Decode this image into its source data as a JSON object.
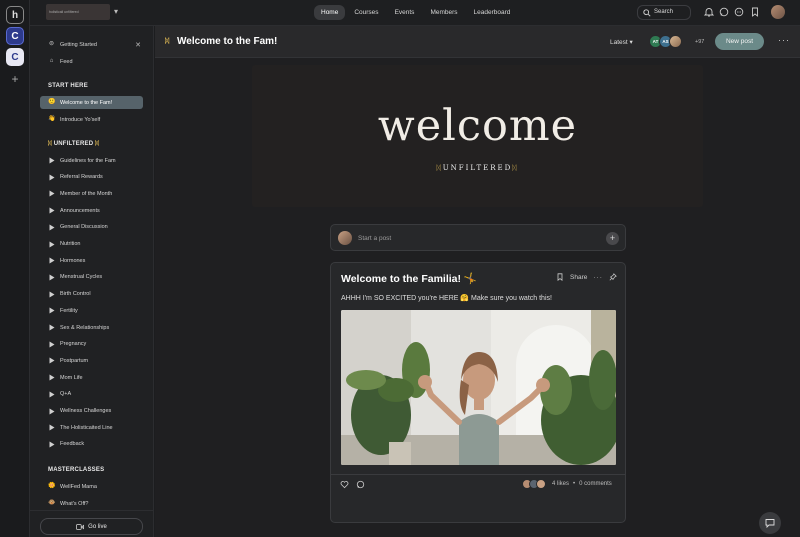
{
  "brand": {
    "logo_text": "holisticali unfiltered"
  },
  "nav": {
    "tabs": [
      {
        "label": "Home",
        "active": true
      },
      {
        "label": "Courses"
      },
      {
        "label": "Events"
      },
      {
        "label": "Members"
      },
      {
        "label": "Leaderboard"
      }
    ]
  },
  "search": {
    "label": "Search"
  },
  "rail": {
    "items": [
      {
        "label": "h",
        "icon": "holisticali-logo"
      },
      {
        "label": "C",
        "icon": "community-c-icon"
      },
      {
        "label": "C",
        "icon": "community-c-icon"
      },
      {
        "label": "+",
        "icon": "plus-icon"
      }
    ]
  },
  "sidebar": {
    "top_items": [
      {
        "label": "Getting Started",
        "icon": "checklist-icon"
      },
      {
        "label": "Feed",
        "icon": "home-icon"
      }
    ],
    "start_here": {
      "heading": "START HERE",
      "items": [
        {
          "label": "Welcome to the Fam!",
          "icon": "🙂",
          "active": true
        },
        {
          "label": "Introduce Yo'self",
          "icon": "👋"
        }
      ]
    },
    "unfiltered": {
      "heading": "UNFILTERED",
      "items": [
        {
          "label": "Guidelines for the Fam"
        },
        {
          "label": "Referral Rewards"
        },
        {
          "label": "Member of the Month"
        },
        {
          "label": "Announcements"
        },
        {
          "label": "General Discussion"
        },
        {
          "label": "Nutrition"
        },
        {
          "label": "Hormones"
        },
        {
          "label": "Menstrual Cycles"
        },
        {
          "label": "Birth Control"
        },
        {
          "label": "Fertility"
        },
        {
          "label": "Sex & Relationships"
        },
        {
          "label": "Pregnancy"
        },
        {
          "label": "Postpartum"
        },
        {
          "label": "Mom Life"
        },
        {
          "label": "Q+A"
        },
        {
          "label": "Wellness Challenges"
        },
        {
          "label": "The Holisticaited Line"
        },
        {
          "label": "Feedback"
        }
      ]
    },
    "masterclasses": {
      "heading": "MASTERCLASSES",
      "items": [
        {
          "label": "WellFed Mama",
          "icon": "🌼"
        },
        {
          "label": "What's Off?",
          "icon": "🐵"
        }
      ]
    },
    "go_live": "Go live"
  },
  "header": {
    "title": "Welcome to the Fam!",
    "sort": "Latest",
    "members": [
      {
        "initials": "AT",
        "color": "#2f7a52"
      },
      {
        "initials": "AS",
        "color": "#3d6f8e"
      },
      {
        "initials": "",
        "color": "#b9926e"
      }
    ],
    "more_count": "+97",
    "new_post": "New post"
  },
  "banner": {
    "word": "welcome",
    "sub": "UNFILTERED"
  },
  "composer": {
    "placeholder": "Start a post"
  },
  "post": {
    "title": "Welcome to the Familia! 🤸",
    "share": "Share",
    "body": "AHHH I'm SO EXCITED you're HERE 🤗 Make sure you watch this!",
    "likes": "4 likes",
    "comments": "0 comments"
  },
  "colors": {
    "accent": "#6b8a89",
    "gold": "#c9a84f",
    "active_channel": "#56636a"
  }
}
